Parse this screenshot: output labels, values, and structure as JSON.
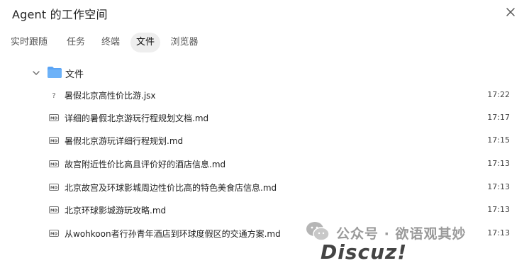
{
  "window": {
    "title": "Agent 的工作空间",
    "close_icon": "close-icon"
  },
  "tabs": [
    {
      "label": "实时跟随",
      "active": false
    },
    {
      "label": "任务",
      "active": false
    },
    {
      "label": "终端",
      "active": false
    },
    {
      "label": "文件",
      "active": true
    },
    {
      "label": "浏览器",
      "active": false
    }
  ],
  "tree": {
    "folder": {
      "label": "文件",
      "expanded": true,
      "icon": "folder-icon",
      "color": "#5aa4f5"
    },
    "files": [
      {
        "name": "暑假北京高性价比游.jsx",
        "time": "17:22",
        "icon": "unknown-file-icon",
        "icon_text": "?"
      },
      {
        "name": "详细的暑假北京游玩行程规划文档.md",
        "time": "17:17",
        "icon": "markdown-file-icon",
        "icon_text": "MD"
      },
      {
        "name": "暑假北京游玩详细行程规划.md",
        "time": "17:15",
        "icon": "markdown-file-icon",
        "icon_text": "MD"
      },
      {
        "name": "故宫附近性价比高且评价好的酒店信息.md",
        "time": "17:13",
        "icon": "markdown-file-icon",
        "icon_text": "MD"
      },
      {
        "name": "北京故宫及环球影城周边性价比高的特色美食店信息.md",
        "time": "17:13",
        "icon": "markdown-file-icon",
        "icon_text": "MD"
      },
      {
        "name": "北京环球影城游玩攻略.md",
        "time": "17:13",
        "icon": "markdown-file-icon",
        "icon_text": "MD"
      },
      {
        "name": "从wohkoon者行孙青年酒店到环球度假区的交通方案.md",
        "time": "17:13",
        "icon": "markdown-file-icon",
        "icon_text": "MD"
      }
    ]
  },
  "watermark": {
    "line1": "公众号 · 欲语观其妙",
    "line2": "Discuz!"
  }
}
